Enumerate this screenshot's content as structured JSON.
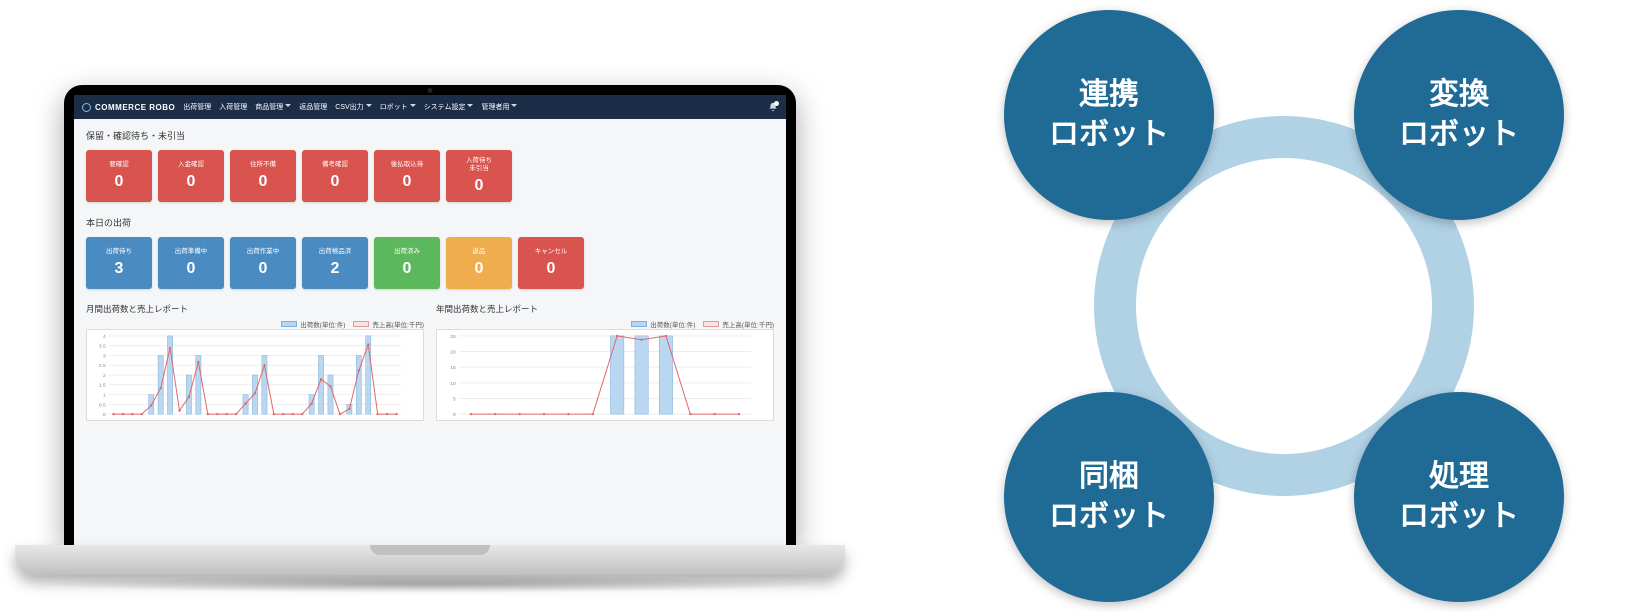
{
  "brand": {
    "name": "COMMERCE ROBO"
  },
  "nav": [
    {
      "label": "出荷管理",
      "dropdown": false
    },
    {
      "label": "入荷管理",
      "dropdown": false
    },
    {
      "label": "商品管理",
      "dropdown": true
    },
    {
      "label": "返品管理",
      "dropdown": false
    },
    {
      "label": "CSV出力",
      "dropdown": true
    },
    {
      "label": "ロボット",
      "dropdown": true
    },
    {
      "label": "システム設定",
      "dropdown": true
    },
    {
      "label": "管理者用",
      "dropdown": true
    }
  ],
  "pending": {
    "title": "保留・確認待ち・未引当",
    "tiles": [
      {
        "label": "要確認",
        "value": 0,
        "color": "c-red"
      },
      {
        "label": "入金確認",
        "value": 0,
        "color": "c-red"
      },
      {
        "label": "住所不備",
        "value": 0,
        "color": "c-red"
      },
      {
        "label": "備考確認",
        "value": 0,
        "color": "c-red"
      },
      {
        "label": "後払取込待",
        "value": 0,
        "color": "c-red"
      },
      {
        "label": "入荷待ち\n未引当",
        "value": 0,
        "color": "c-red"
      }
    ]
  },
  "today": {
    "title": "本日の出荷",
    "tiles": [
      {
        "label": "出荷待ち",
        "value": 3,
        "color": "c-blue"
      },
      {
        "label": "出荷準備中",
        "value": 0,
        "color": "c-blue"
      },
      {
        "label": "出荷作業中",
        "value": 0,
        "color": "c-blue"
      },
      {
        "label": "出荷検品済",
        "value": 2,
        "color": "c-blue"
      },
      {
        "label": "出荷済み",
        "value": 0,
        "color": "c-green"
      },
      {
        "label": "返品",
        "value": 0,
        "color": "c-orange"
      },
      {
        "label": "キャンセル",
        "value": 0,
        "color": "c-red"
      }
    ]
  },
  "monthly": {
    "title": "月間出荷数と売上レポート",
    "legend": {
      "bar": "出荷数(単位:件)",
      "line": "売上高(単位:千円)"
    },
    "ylim_left": [
      0,
      4.0
    ],
    "ylim_right": [
      0,
      45
    ]
  },
  "yearly": {
    "title": "年間出荷数と売上レポート",
    "legend": {
      "bar": "出荷数(単位:件)",
      "line": "売上高(単位:千円)"
    },
    "ylim_left": [
      0,
      25
    ],
    "ylim_right": [
      0,
      200
    ]
  },
  "robots": {
    "tl": "連携\nロボット",
    "tr": "変換\nロボット",
    "bl": "同梱\nロボット",
    "br": "処理\nロボット"
  },
  "chart_data": [
    {
      "type": "bar",
      "title": "月間出荷数と売上レポート",
      "xlabel": "",
      "ylabel_left": "出荷数(単位:件)",
      "ylabel_right": "売上高(単位:千円)",
      "ylim_left": [
        0,
        4.0
      ],
      "yticks_left": [
        0.0,
        0.5,
        1.0,
        1.5,
        2.0,
        2.5,
        3.0,
        3.5,
        4.0
      ],
      "ylim_right": [
        0,
        45
      ],
      "categories_count": 31,
      "series": [
        {
          "name": "出荷数(単位:件)",
          "axis": "left",
          "kind": "bar",
          "values": [
            0,
            0,
            0,
            0,
            1,
            3,
            4,
            0,
            2,
            3,
            0,
            0,
            0,
            0,
            1,
            2,
            3,
            0,
            0,
            0,
            0,
            1,
            3,
            2,
            0,
            0.5,
            3,
            4,
            0,
            0,
            0
          ]
        },
        {
          "name": "売上高(単位:千円)",
          "axis": "right",
          "kind": "line",
          "values": [
            0,
            0,
            0,
            0,
            5,
            15,
            38,
            2,
            10,
            30,
            0,
            0,
            0,
            0,
            6,
            12,
            28,
            0,
            0,
            0,
            0,
            6,
            20,
            16,
            0,
            3,
            25,
            40,
            0,
            0,
            0
          ]
        }
      ]
    },
    {
      "type": "bar",
      "title": "年間出荷数と売上レポート",
      "xlabel": "",
      "ylabel_left": "出荷数(単位:件)",
      "ylabel_right": "売上高(単位:千円)",
      "ylim_left": [
        0,
        25
      ],
      "yticks_left": [
        0,
        5,
        10,
        15,
        20,
        25
      ],
      "ylim_right": [
        0,
        200
      ],
      "categories_count": 12,
      "series": [
        {
          "name": "出荷数(単位:件)",
          "axis": "left",
          "kind": "bar",
          "values": [
            0,
            0,
            0,
            0,
            0,
            0,
            25,
            25,
            25,
            0,
            0,
            0
          ]
        },
        {
          "name": "売上高(単位:千円)",
          "axis": "right",
          "kind": "line",
          "values": [
            0,
            0,
            0,
            0,
            0,
            0,
            200,
            190,
            200,
            0,
            0,
            0
          ]
        }
      ]
    }
  ]
}
